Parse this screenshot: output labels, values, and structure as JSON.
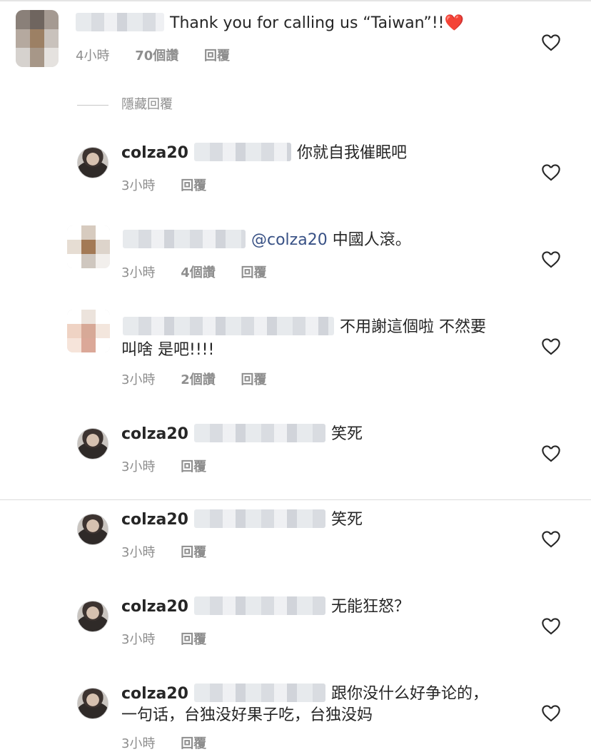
{
  "top_comment": {
    "text": "Thank you for calling us “Taiwan”!!❤️",
    "time": "4小時",
    "likes": "70個讚",
    "reply": "回覆"
  },
  "hide_replies": "隱藏回覆",
  "replies": [
    {
      "user": "colza20",
      "text": "你就自我催眠吧",
      "time": "3小時",
      "likes": "",
      "reply": "回覆"
    },
    {
      "user": "",
      "mention": "@colza20",
      "text": "中國人滾。",
      "time": "3小時",
      "likes": "4個讚",
      "reply": "回覆"
    },
    {
      "user": "",
      "text": "不用謝這個啦 不然要",
      "text2": "叫啥 是吧!!!!",
      "time": "3小時",
      "likes": "2個讚",
      "reply": "回覆"
    },
    {
      "user": "colza20",
      "text": "笑死",
      "time": "3小時",
      "likes": "",
      "reply": "回覆"
    }
  ],
  "comments_below": [
    {
      "user": "colza20",
      "text": "笑死",
      "time": "3小時",
      "reply": "回覆"
    },
    {
      "user": "colza20",
      "text": "无能狂怒？",
      "time": "3小時",
      "reply": "回覆"
    },
    {
      "user": "colza20",
      "text": "跟你没什么好争论的，",
      "text2": "一句话，台独没好果子吃，台独没妈",
      "time": "3小時",
      "reply": "回覆"
    }
  ],
  "icons": {
    "like": "heart-outline-icon"
  }
}
